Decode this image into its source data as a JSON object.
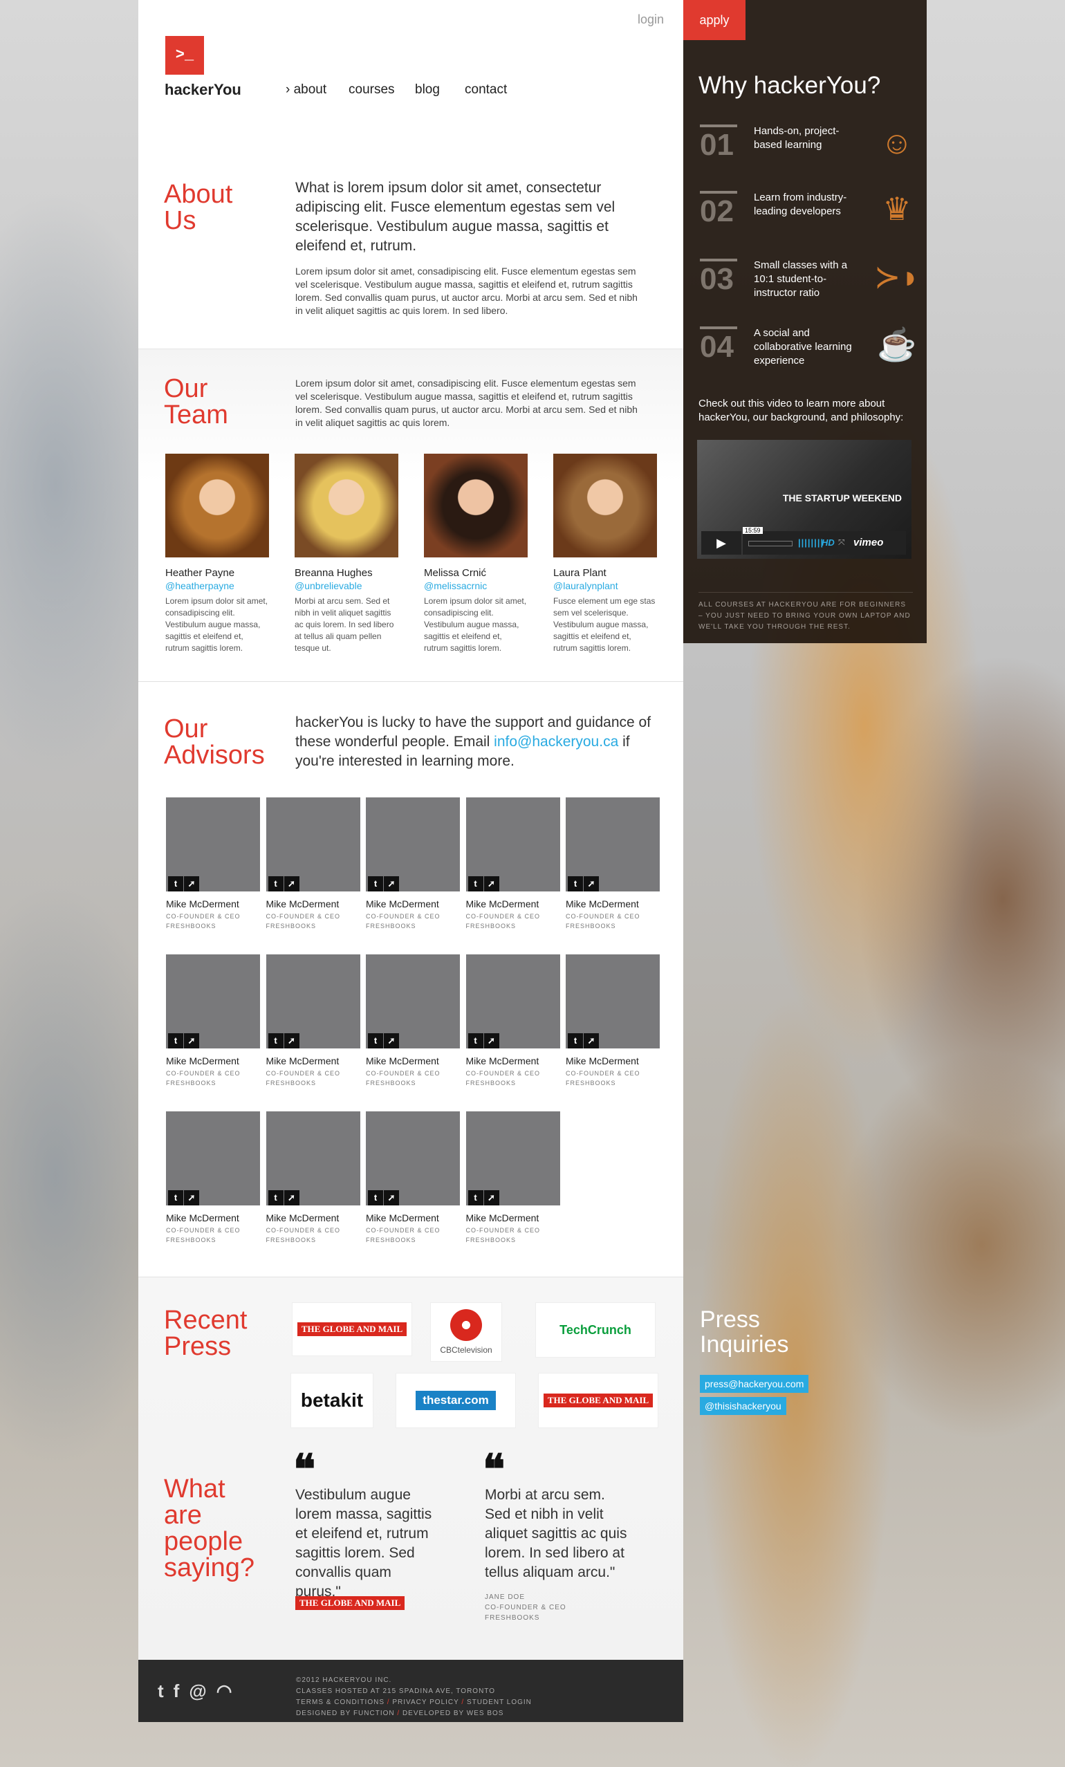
{
  "header": {
    "login": "login",
    "apply": "apply",
    "brand": "hackerYou",
    "logo_glyph": ">_",
    "nav": [
      {
        "label": "› about",
        "active": true
      },
      {
        "label": "courses"
      },
      {
        "label": "blog"
      },
      {
        "label": "contact"
      }
    ]
  },
  "about": {
    "title_1": "About",
    "title_2": "Us",
    "lead": "What is lorem ipsum dolor sit amet, consectetur adipiscing elit. Fusce elementum egestas sem vel scelerisque. Vestibulum augue massa, sagittis et eleifend et, rutrum.",
    "body": "Lorem ipsum dolor sit amet, consadipiscing elit. Fusce elementum egestas sem vel scelerisque. Vestibulum augue massa, sagittis et eleifend et, rutrum sagittis lorem. Sed convallis quam purus, ut auctor arcu. Morbi at arcu sem. Sed et nibh in velit aliquet sagittis ac quis lorem. In sed libero."
  },
  "team": {
    "title_1": "Our",
    "title_2": "Team",
    "body": "Lorem ipsum dolor sit amet, consadipiscing elit. Fusce elementum egestas sem vel scelerisque. Vestibulum augue massa, sagittis et eleifend et, rutrum sagittis lorem. Sed convallis quam purus, ut auctor arcu. Morbi at arcu sem. Sed et nibh in velit aliquet sagittis ac quis lorem.",
    "members": [
      {
        "name": "Heather Payne",
        "handle": "@heatherpayne",
        "bio": "Lorem ipsum dolor sit amet, consadipiscing elit. Vestibulum augue massa, sagittis et eleifend et, rutrum sagittis lorem."
      },
      {
        "name": "Breanna Hughes",
        "handle": "@unbrelievable",
        "bio": "Morbi at arcu sem. Sed et nibh in velit aliquet sagittis ac quis lorem. In sed libero at tellus ali quam pellen tesque ut."
      },
      {
        "name": "Melissa Crnić",
        "handle": "@melissacrnic",
        "bio": "Lorem ipsum dolor sit amet, consadipiscing elit. Vestibulum augue massa, sagittis et eleifend et, rutrum sagittis lorem."
      },
      {
        "name": "Laura Plant",
        "handle": "@lauralynplant",
        "bio": "Fusce element um ege stas sem vel scelerisque. Vestibulum augue massa, sagittis et eleifend et, rutrum sagittis lorem."
      }
    ]
  },
  "advisors": {
    "title_1": "Our",
    "title_2": "Advisors",
    "lead_a": "hackerYou is lucky to have the support and guidance of these wonderful people. Email ",
    "email": "info@hackeryou.ca",
    "lead_b": " if you're interested in learning more.",
    "name": "Mike McDerment",
    "role_1": "CO-FOUNDER & CEO",
    "role_2": "FRESHBOOKS",
    "count": 14
  },
  "press": {
    "title_1": "Recent",
    "title_2": "Press",
    "logos": [
      "THE GLOBE AND MAIL",
      "CBCtelevision",
      "TechCrunch",
      "betakit",
      "thestar.com",
      "THE GLOBE AND MAIL"
    ]
  },
  "testimonials": {
    "title_1": "What",
    "title_2": "are",
    "title_3": "people",
    "title_4": "saying?",
    "q1": "Vestibulum augue lorem massa, sagittis et eleifend et, rutrum sagittis lorem. Sed convallis quam purus.\"",
    "q1_source": "THE GLOBE AND MAIL",
    "q2": "Morbi at arcu sem. Sed et nibh in velit aliquet sagittis ac quis lorem. In sed libero at tellus aliquam arcu.\"",
    "q2_name": "JANE DOE",
    "q2_role_1": "CO-FOUNDER & CEO",
    "q2_role_2": "FRESHBOOKS"
  },
  "sidebar": {
    "title": "Why hackerYou?",
    "steps": [
      {
        "num": "01",
        "text": "Hands-on, project-based learning",
        "icon": "person-icon"
      },
      {
        "num": "02",
        "text": "Learn from industry-leading developers",
        "icon": "trophy-icon"
      },
      {
        "num": "03",
        "text": "Small classes with a 10:1 student-to-instructor ratio",
        "icon": "fish-icon"
      },
      {
        "num": "04",
        "text": "A social and collaborative learning experience",
        "icon": "coffee-icon"
      }
    ],
    "video_text": "Check out this video to learn more about hackerYou, our background, and philosophy:",
    "video_title": "THE STARTUP WEEKEND",
    "video_time": "15:59",
    "video_hd": "HD",
    "video_brand": "vimeo",
    "note": "ALL COURSES AT HACKERYOU ARE FOR BEGINNERS – YOU JUST NEED TO BRING YOUR OWN LAPTOP AND WE'LL TAKE YOU THROUGH THE REST."
  },
  "press_inquiries": {
    "title_1": "Press",
    "title_2": "Inquiries",
    "email": "press@hackeryou.com",
    "twitter": "@thisishackeryou"
  },
  "footer": {
    "l1": "©2012 HACKERYOU INC.",
    "l2": "CLASSES HOSTED AT 215 SPADINA AVE, TORONTO",
    "terms": "TERMS & CONDITIONS",
    "privacy": "PRIVACY POLICY",
    "student": "STUDENT LOGIN",
    "designed": "DESIGNED BY FUNCTION",
    "developed": "DEVELOPED BY WES BOS",
    "sep": "/"
  },
  "colors": {
    "accent": "#e03a2f",
    "link": "#29aae1",
    "sidebar": "#1c120a",
    "placeholder": "#79797b"
  }
}
